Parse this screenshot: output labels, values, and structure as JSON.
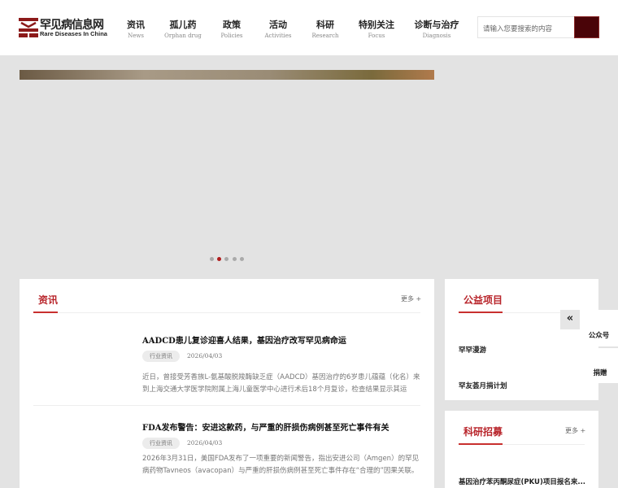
{
  "logo": {
    "cn": "罕见病信息网",
    "en": "Rare Diseases In China"
  },
  "nav": [
    {
      "cn": "资讯",
      "en": "News"
    },
    {
      "cn": "孤儿药",
      "en": "Orphan drug"
    },
    {
      "cn": "政策",
      "en": "Policies"
    },
    {
      "cn": "活动",
      "en": "Activities"
    },
    {
      "cn": "科研",
      "en": "Research"
    },
    {
      "cn": "特别关注",
      "en": "Focus"
    },
    {
      "cn": "诊断与治疗",
      "en": "Diagnosis"
    }
  ],
  "search": {
    "placeholder": "请输入您要搜索的内容"
  },
  "carousel": {
    "count": 5,
    "active": 1
  },
  "news": {
    "title": "资讯",
    "more": "更多 +",
    "items": [
      {
        "title": "AADCD患儿复诊迎喜人结果，基因治疗改写罕见病命运",
        "tag": "行业资讯",
        "date": "2026/04/03",
        "desc": "近日，曾接受芳香族L-氨基酸脱羧酶缺乏症（AADCD）基因治疗的6岁患儿蕴蕴（化名）来到上海交通大学医学院附属上海儿童医学中心进行术后18个月复诊，检查结果显示其运动、语..."
      },
      {
        "title": "FDA发布警告：安进这款药，与严重的肝损伤病例甚至死亡事件有关",
        "tag": "行业资讯",
        "date": "2026/04/03",
        "desc": "2026年3月31日，美国FDA发布了一项重要的新闻警告，指出安进公司（Amgen）的罕见病药物Tavneos（avacopan）与严重的肝损伤病例甚至死亡事件存在“合理的”因果关联。"
      }
    ]
  },
  "charity": {
    "title": "公益项目",
    "items": [
      "罕罕漫游",
      "罕友荟月捐计划"
    ]
  },
  "research": {
    "title": "科研招募",
    "more": "更多 +",
    "items": [
      "基因治疗苯丙酮尿症(PKU)项目报名来..."
    ]
  },
  "float": {
    "collapse": "«",
    "wechat": "公众号",
    "donate": "捐赠"
  }
}
